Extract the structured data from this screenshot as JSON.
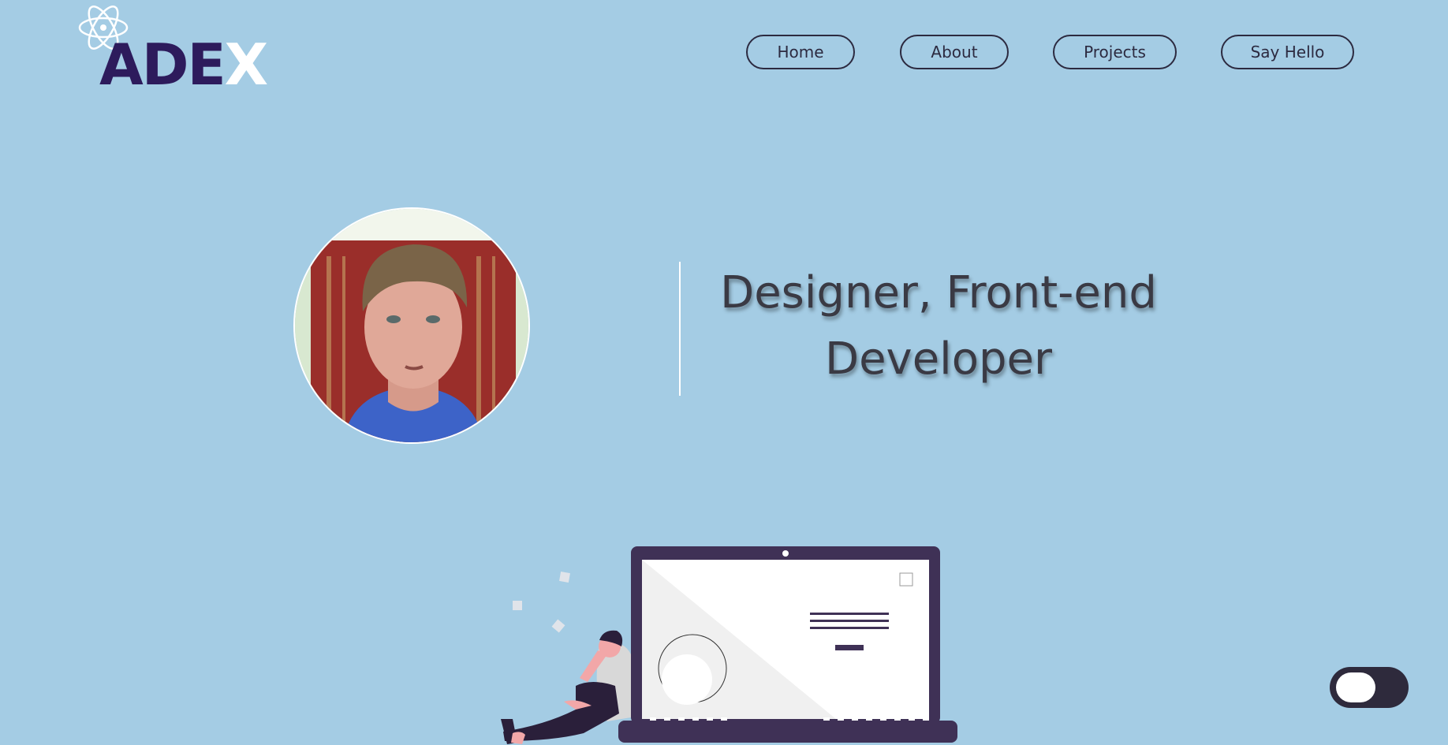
{
  "brand": {
    "logo_text_dark": "ADE",
    "logo_text_light": "X",
    "logo_icon": "atom-icon",
    "colors": {
      "dark": "#2d1b5c",
      "light": "#ffffff"
    }
  },
  "nav": {
    "items": [
      {
        "label": "Home"
      },
      {
        "label": "About"
      },
      {
        "label": "Projects"
      },
      {
        "label": "Say Hello"
      }
    ]
  },
  "hero": {
    "headline_line1": "Designer, Front-end",
    "headline_line2": "Developer",
    "avatar": "profile-photo"
  },
  "illustration": {
    "name": "person-with-laptop-illustration"
  },
  "theme_toggle": {
    "state": "off"
  },
  "colors": {
    "background": "#a4cce4",
    "text": "#3a3a44",
    "accent_dark": "#3f3156"
  }
}
